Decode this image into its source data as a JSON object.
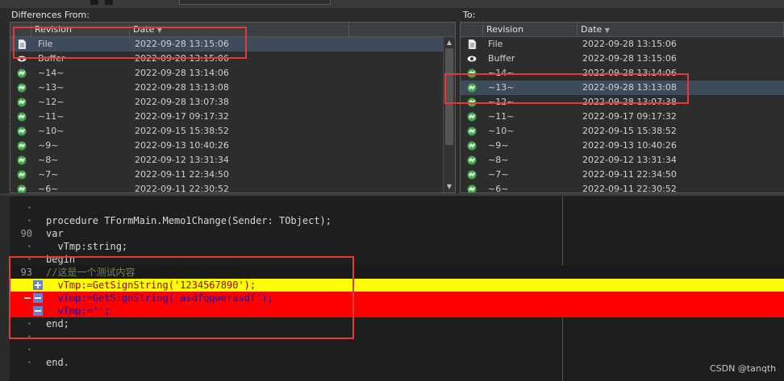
{
  "left_panel": {
    "title": "Differences From:",
    "columns": [
      "Revision",
      "Date"
    ],
    "rows": [
      {
        "icon": "file-icon",
        "rev": "File",
        "date": "2022-09-28 13:15:06",
        "selected": true
      },
      {
        "icon": "eye-icon",
        "rev": "Buffer",
        "date": "2022-09-28 13:15:06"
      },
      {
        "icon": "revision-icon",
        "rev": "~14~",
        "date": "2022-09-28 13:14:06"
      },
      {
        "icon": "revision-icon",
        "rev": "~13~",
        "date": "2022-09-28 13:13:08"
      },
      {
        "icon": "revision-icon",
        "rev": "~12~",
        "date": "2022-09-28 13:07:38"
      },
      {
        "icon": "revision-icon",
        "rev": "~11~",
        "date": "2022-09-17 09:17:32"
      },
      {
        "icon": "revision-icon",
        "rev": "~10~",
        "date": "2022-09-15 15:38:52"
      },
      {
        "icon": "revision-icon",
        "rev": "~9~",
        "date": "2022-09-13 10:40:26"
      },
      {
        "icon": "revision-icon",
        "rev": "~8~",
        "date": "2022-09-12 13:31:34"
      },
      {
        "icon": "revision-icon",
        "rev": "~7~",
        "date": "2022-09-11 22:34:50"
      },
      {
        "icon": "revision-icon",
        "rev": "~6~",
        "date": "2022-09-11 22:30:52"
      }
    ]
  },
  "right_panel": {
    "title": "To:",
    "columns": [
      "Revision",
      "Date"
    ],
    "rows": [
      {
        "icon": "file-icon",
        "rev": "File",
        "date": "2022-09-28 13:15:06"
      },
      {
        "icon": "eye-icon",
        "rev": "Buffer",
        "date": "2022-09-28 13:15:06"
      },
      {
        "icon": "revision-icon",
        "rev": "~14~",
        "date": "2022-09-28 13:14:06"
      },
      {
        "icon": "revision-icon",
        "rev": "~13~",
        "date": "2022-09-28 13:13:08",
        "selected": true
      },
      {
        "icon": "revision-icon",
        "rev": "~12~",
        "date": "2022-09-28 13:07:38"
      },
      {
        "icon": "revision-icon",
        "rev": "~11~",
        "date": "2022-09-17 09:17:32"
      },
      {
        "icon": "revision-icon",
        "rev": "~10~",
        "date": "2022-09-15 15:38:52"
      },
      {
        "icon": "revision-icon",
        "rev": "~9~",
        "date": "2022-09-13 10:40:26"
      },
      {
        "icon": "revision-icon",
        "rev": "~8~",
        "date": "2022-09-12 13:31:34"
      },
      {
        "icon": "revision-icon",
        "rev": "~7~",
        "date": "2022-09-11 22:34:50"
      },
      {
        "icon": "revision-icon",
        "rev": "~6~",
        "date": "2022-09-11 22:30:52"
      }
    ]
  },
  "editor": {
    "lines": [
      {
        "num": "·",
        "code": "",
        "kind": "normal"
      },
      {
        "num": "·",
        "code": "procedure TFormMain.Memo1Change(Sender: TObject);",
        "kind": "normal"
      },
      {
        "num": "90",
        "code": "var",
        "kind": "normal"
      },
      {
        "num": "·",
        "code": "  vTmp:string;",
        "kind": "normal"
      },
      {
        "num": "·",
        "code": "begin",
        "kind": "normal"
      },
      {
        "num": "93",
        "code": "//这是一个测试内容",
        "kind": "cur"
      },
      {
        "num": "",
        "code": "  vTmp:=GetSignString('1234567890');",
        "kind": "add",
        "marker": "plus"
      },
      {
        "num": "",
        "code": "  vTmp:=GetSignString('asdfqqwerasdf');",
        "kind": "del",
        "marker": "minus",
        "change": true
      },
      {
        "num": "",
        "code": "  vTmp:='';",
        "kind": "del",
        "marker": "minus"
      },
      {
        "num": "·",
        "code": "end;",
        "kind": "normal"
      },
      {
        "num": "·",
        "code": "",
        "kind": "normal"
      },
      {
        "num": "·",
        "code": "",
        "kind": "normal"
      },
      {
        "num": "·",
        "code": "end.",
        "kind": "normal"
      }
    ]
  },
  "watermark": "CSDN @tanqth",
  "colors": {
    "added_line": "#ffff00",
    "deleted_line": "#ff0000",
    "highlight_box": "#e53935"
  }
}
